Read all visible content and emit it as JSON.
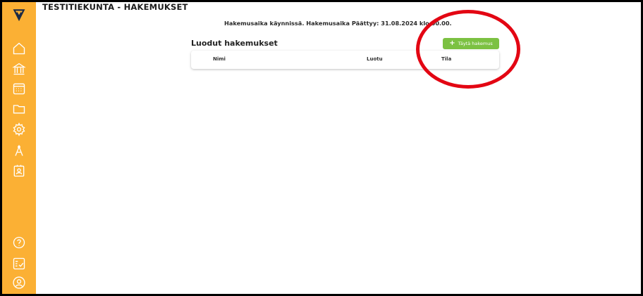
{
  "app": {
    "title": "TESTITIEKUNTA - HAKEMUKSET"
  },
  "sidebar": {
    "items": [
      {
        "icon": "logo-shield-icon"
      },
      {
        "icon": "home-icon"
      },
      {
        "icon": "bank-icon"
      },
      {
        "icon": "calendar-icon"
      },
      {
        "icon": "folder-icon"
      },
      {
        "icon": "gear-icon"
      },
      {
        "icon": "compass-icon"
      },
      {
        "icon": "id-badge-icon"
      },
      {
        "icon": "help-icon"
      },
      {
        "icon": "checklist-icon"
      },
      {
        "icon": "user-icon"
      }
    ]
  },
  "main": {
    "period_text": "Hakemusaika käynnissä. Hakemusaika Päättyy: 31.08.2024 klo 00.00.",
    "section_title": "Luodut hakemukset",
    "add_button": {
      "label": "Täytä hakemus"
    },
    "table": {
      "columns": [
        "Nimi",
        "Luotu",
        "Tila"
      ]
    }
  },
  "colors": {
    "sidebar": "#fbb034",
    "button": "#7cc142",
    "annotation": "#e30613"
  }
}
